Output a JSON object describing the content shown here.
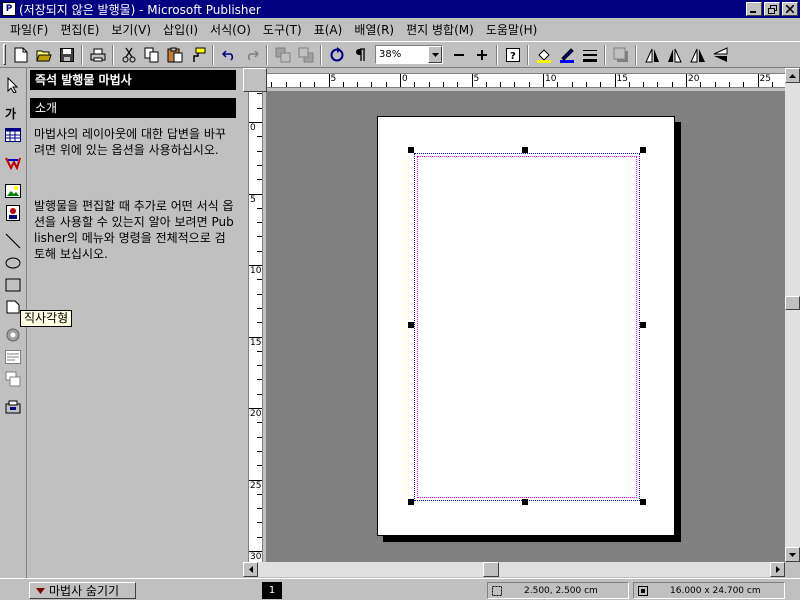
{
  "window": {
    "title": "(저장되지 않은 발행물) - Microsoft Publisher",
    "controls": [
      "minimize-icon",
      "restore-icon",
      "close-icon"
    ]
  },
  "menubar": {
    "items": [
      {
        "label": "파일(F)"
      },
      {
        "label": "편집(E)"
      },
      {
        "label": "보기(V)"
      },
      {
        "label": "삽입(I)"
      },
      {
        "label": "서식(O)"
      },
      {
        "label": "도구(T)"
      },
      {
        "label": "표(A)"
      },
      {
        "label": "배열(R)"
      },
      {
        "label": "편지 병합(M)"
      },
      {
        "label": "도움말(H)"
      }
    ]
  },
  "toolbar": {
    "zoom": "38%",
    "buttons": [
      "new-icon",
      "open-icon",
      "save-icon",
      "print-icon",
      "cut-icon",
      "copy-icon",
      "paste-icon",
      "format-painter-icon",
      "undo-icon",
      "redo-icon",
      "bring-front-icon",
      "send-back-icon",
      "refresh-icon",
      "pilcrow-icon",
      "zoom-out-icon",
      "zoom-in-icon",
      "help-icon",
      "fill-color-icon",
      "line-color-icon",
      "line-style-icon",
      "shadow-icon",
      "rotate-left-icon",
      "rotate-right-icon",
      "flip-horizontal-icon",
      "flip-vertical-icon"
    ]
  },
  "object_toolbar": {
    "tools": [
      "pointer-icon",
      "text-frame-icon",
      "table-frame-icon",
      "wordart-icon",
      "picture-frame-icon",
      "clipart-icon",
      "line-icon",
      "oval-icon",
      "rectangle-icon",
      "custom-shape-icon",
      "ole-icon",
      "design-gallery-icon",
      "form-control-icon",
      "html-icon",
      "web-component-icon"
    ]
  },
  "tooltip": {
    "text": "직사각형"
  },
  "wizard": {
    "title": "즉석 발행물 마법사",
    "subtitle": "소개",
    "paragraph1": "마법사의 레이아웃에 대한 답변을 바꾸려면 위에 있는 옵션을 사용하십시오.",
    "paragraph2": "발행물을 편집할 때 추가로 어떤 서식 옵션을 사용할 수 있는지 알아 보려면 Publisher의 메뉴와 명령을 전체적으로 검토해 보십시오."
  },
  "ruler": {
    "horizontal_labels": [
      "5",
      "0",
      "5",
      "10",
      "15",
      "20",
      "25"
    ],
    "vertical_labels": [
      "0",
      "5",
      "10",
      "15",
      "20",
      "25",
      "30"
    ]
  },
  "statusbar": {
    "hide_wizard_label": "마법사 숨기기",
    "page_number": "1",
    "position": "2.500, 2.500 cm",
    "size": "16.000 x 24.700 cm"
  }
}
